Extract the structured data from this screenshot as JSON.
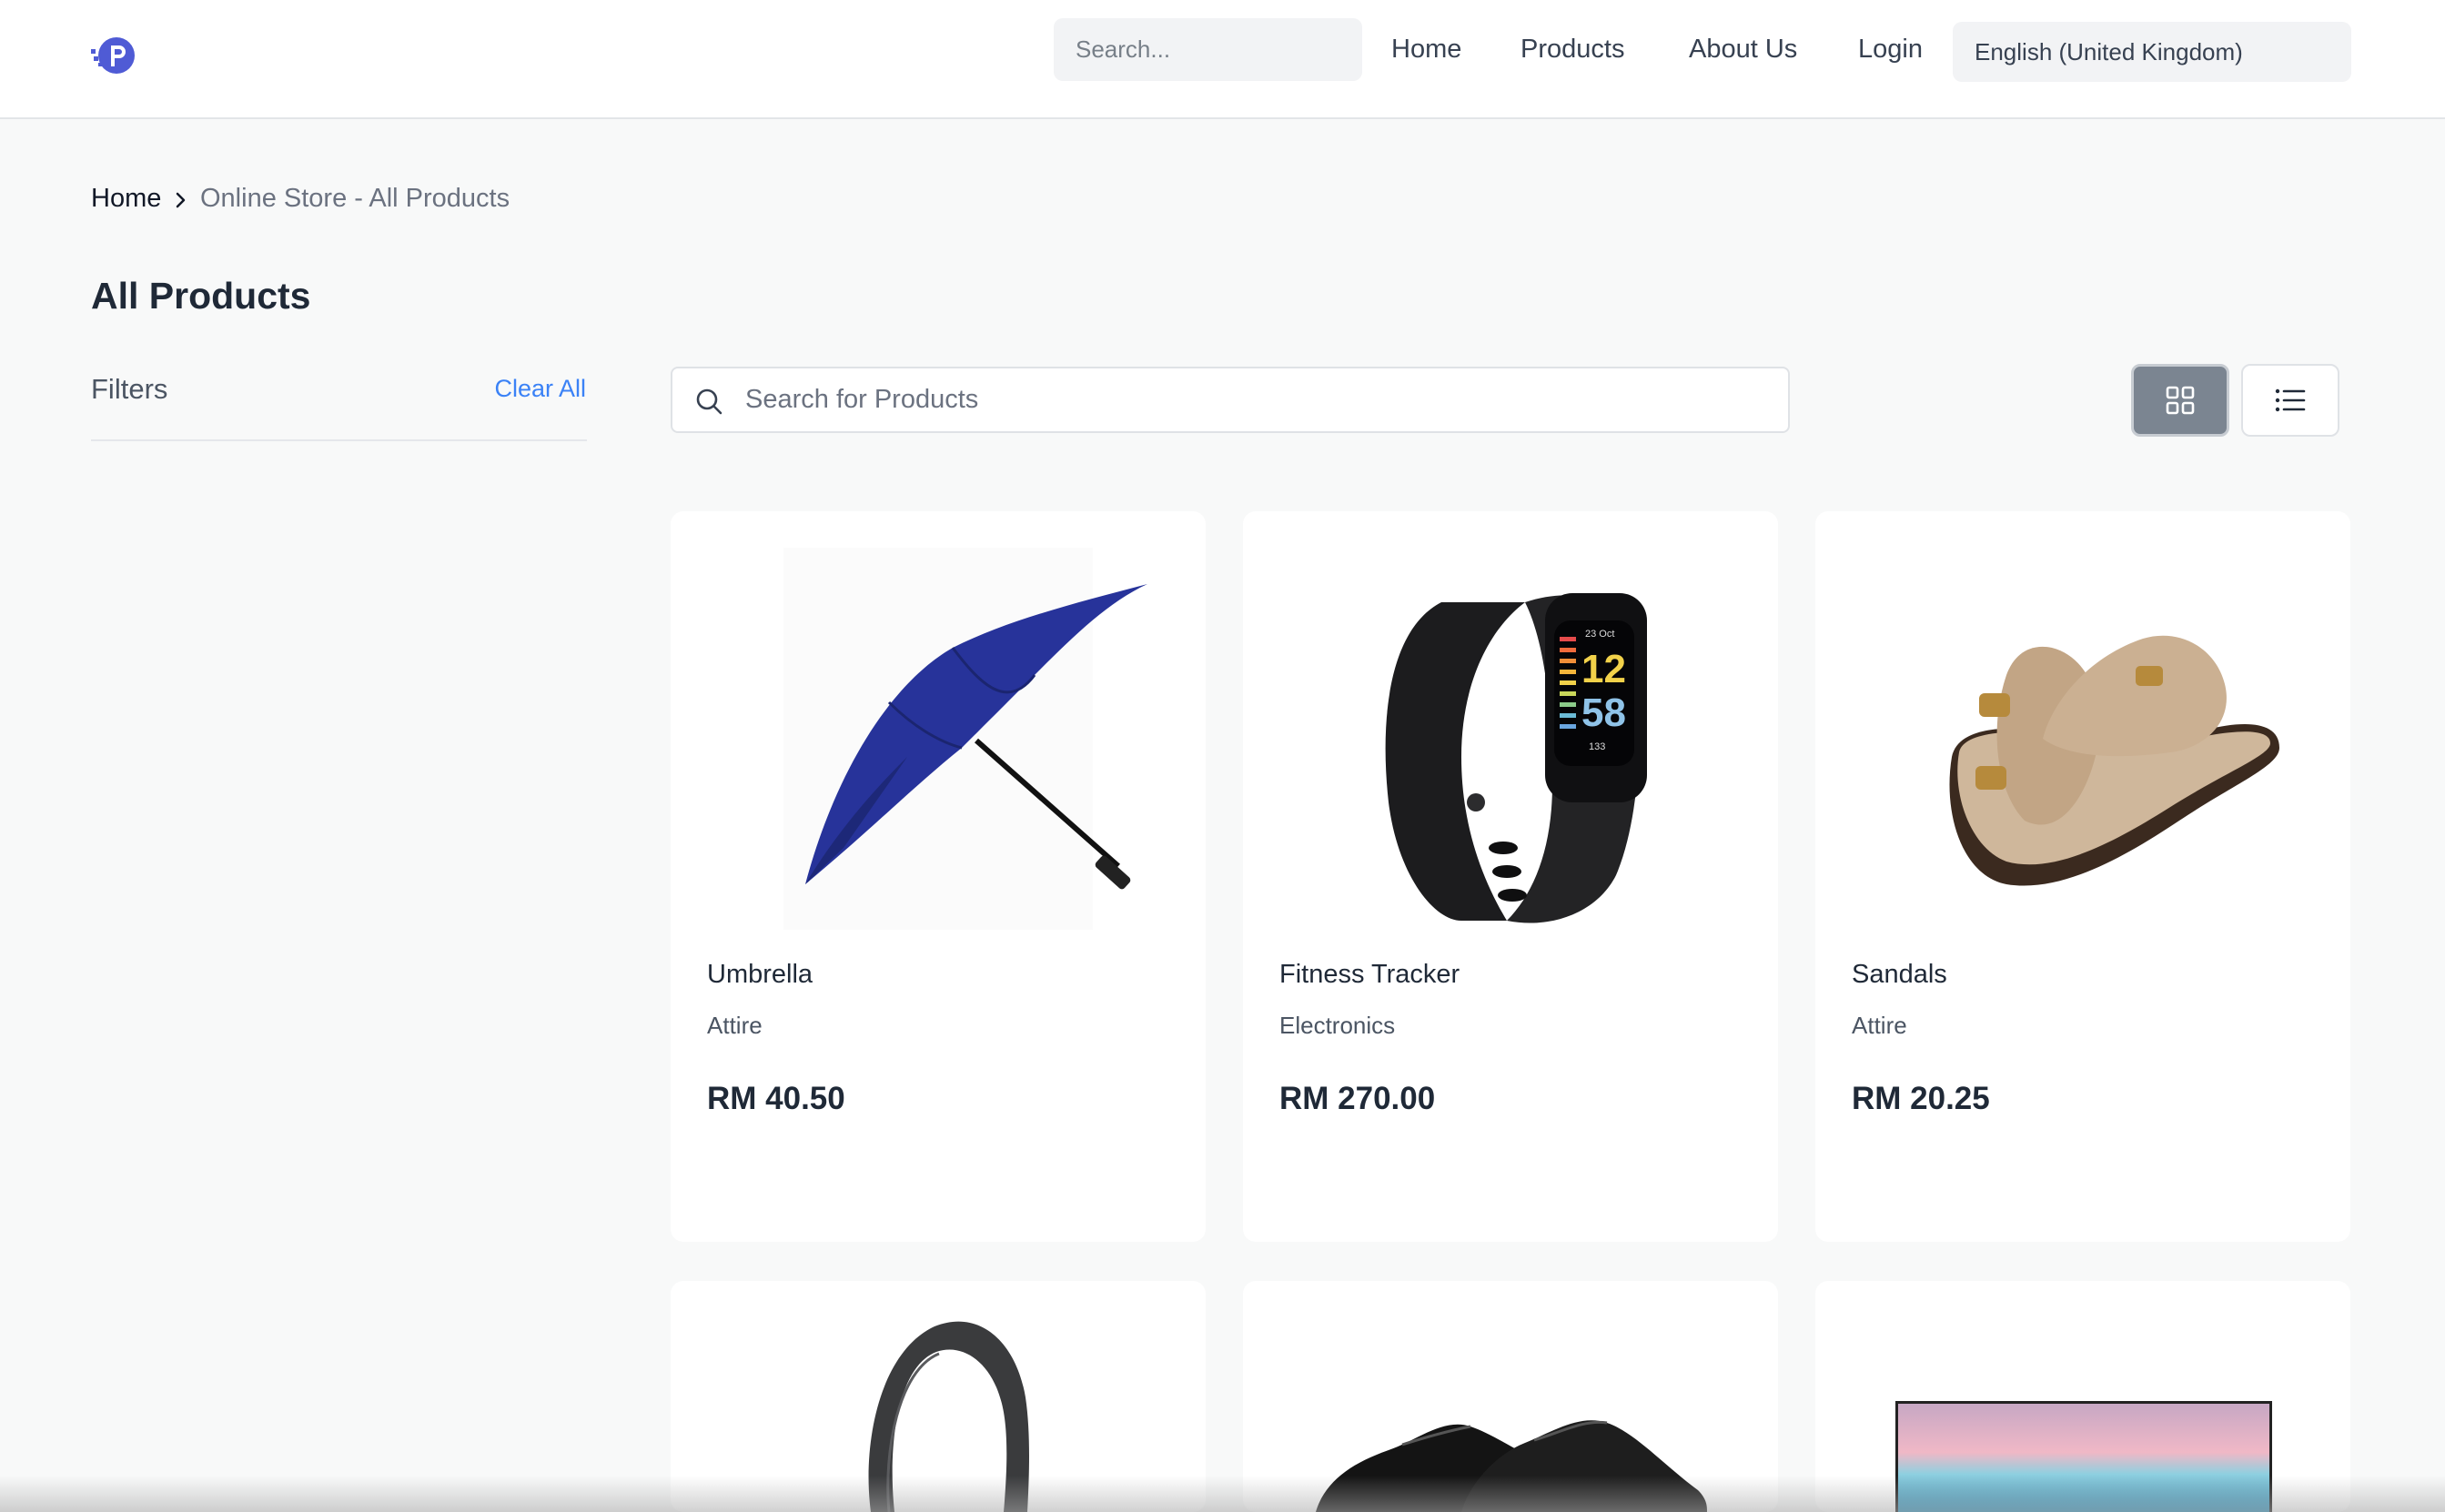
{
  "nav": {
    "search_placeholder": "Search...",
    "links": [
      "Home",
      "Products",
      "About Us",
      "Login"
    ],
    "language": "English (United Kingdom)",
    "brand_color": "#4f5bd5"
  },
  "breadcrumb": {
    "home": "Home",
    "current": "Online Store - All Products"
  },
  "page_title": "All Products",
  "filters": {
    "label": "Filters",
    "clear_all": "Clear All"
  },
  "product_search": {
    "placeholder": "Search for Products"
  },
  "view_toggle": {
    "active": "grid",
    "options": [
      "grid-icon",
      "list-icon"
    ]
  },
  "products": [
    {
      "name": "Umbrella",
      "category": "Attire",
      "price": "RM 40.50",
      "image": "umbrella"
    },
    {
      "name": "Fitness Tracker",
      "category": "Electronics",
      "price": "RM 270.00",
      "image": "fitness-tracker"
    },
    {
      "name": "Sandals",
      "category": "Attire",
      "price": "RM 20.25",
      "image": "sandals"
    },
    {
      "name": "",
      "category": "",
      "price": "",
      "image": "headphones"
    },
    {
      "name": "",
      "category": "",
      "price": "",
      "image": "shoes"
    },
    {
      "name": "",
      "category": "",
      "price": "",
      "image": "tv"
    }
  ],
  "tracker_screen": {
    "date": "23 Oct",
    "hour": "12",
    "minute": "58",
    "heart": "133"
  }
}
